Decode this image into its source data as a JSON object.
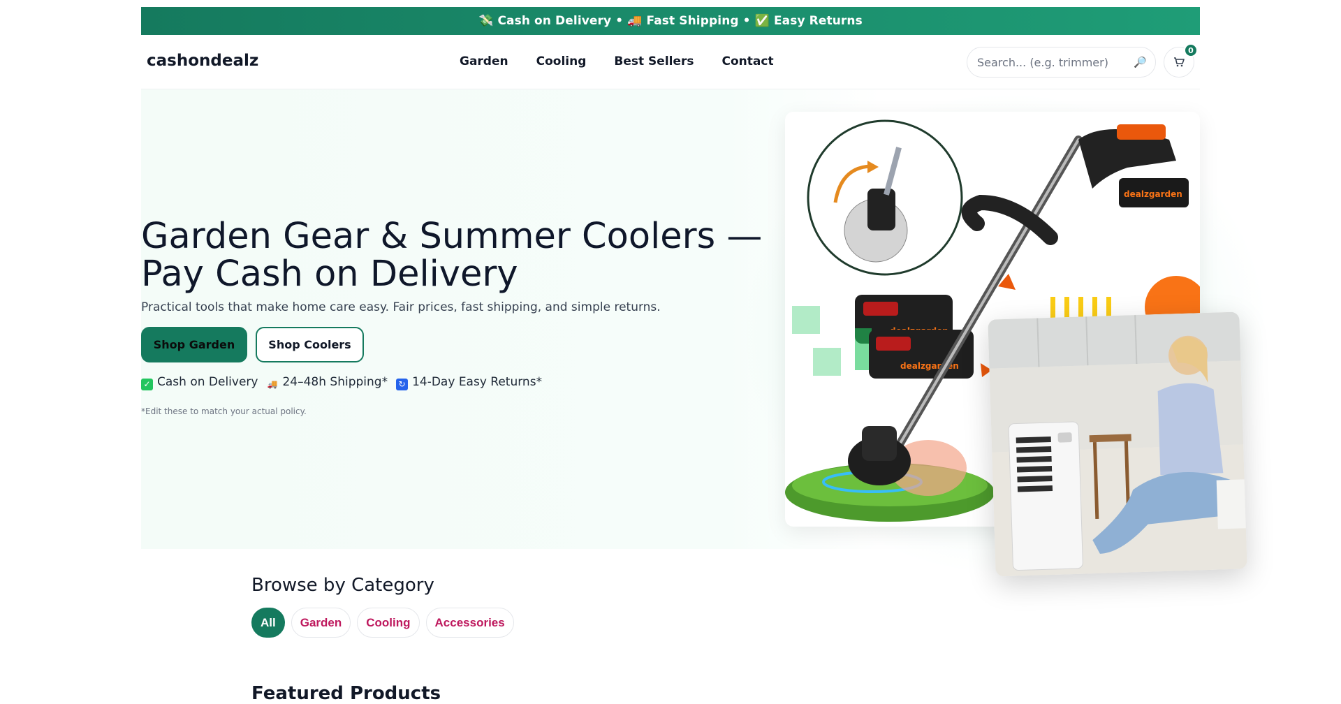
{
  "announcement": "💸 Cash on Delivery • 🚚 Fast Shipping • ✅ Easy Returns",
  "header": {
    "logo": "cashondealz",
    "nav": [
      "Garden",
      "Cooling",
      "Best Sellers",
      "Contact"
    ],
    "search_placeholder": "Search... (e.g. trimmer)",
    "search_icon": "🔎",
    "cart_count": "0"
  },
  "hero": {
    "title": "Garden Gear & Summer Coolers — Pay Cash on Delivery",
    "subtitle": "Practical tools that make home care easy. Fair prices, fast shipping, and simple returns.",
    "primary_cta": "Shop Garden",
    "secondary_cta": "Shop Coolers",
    "trust": [
      {
        "text": "Cash on Delivery",
        "color": "#22c55e"
      },
      {
        "text": "24–48h Shipping*",
        "color": "#ef4444"
      },
      {
        "text": "14-Day Easy Returns*",
        "color": "#2563eb"
      }
    ],
    "note": "*Edit these to match your actual policy.",
    "product_brand": "dealzgarden"
  },
  "categories": {
    "title": "Browse by Category",
    "chips": [
      "All",
      "Garden",
      "Cooling",
      "Accessories"
    ],
    "active": "All"
  },
  "featured_title": "Featured Products",
  "colors": {
    "brand": "#157a5e",
    "chip_text": "#be185d"
  }
}
